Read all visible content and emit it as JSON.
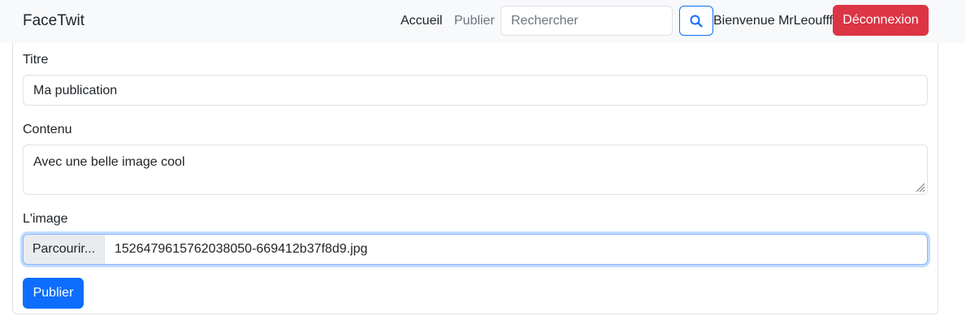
{
  "navbar": {
    "brand": "FaceTwit",
    "links": [
      {
        "label": "Accueil",
        "active": true
      },
      {
        "label": "Publier",
        "active": false
      }
    ],
    "search": {
      "placeholder": "Rechercher",
      "value": "",
      "icon": "search-icon"
    },
    "welcome_text": "Bienvenue MrLeoufff",
    "logout_label": "Déconnexion"
  },
  "form": {
    "title": {
      "label": "Titre",
      "value": "Ma publication"
    },
    "content": {
      "label": "Contenu",
      "value": "Avec une belle image cool"
    },
    "image": {
      "label": "L'image",
      "browse_label": "Parcourir...",
      "filename": "1526479615762038050-669412b37f8d9.jpg"
    },
    "submit_label": "Publier"
  },
  "colors": {
    "primary": "#0d6efd",
    "danger": "#dc3545",
    "navbar_bg": "#f8f9fa",
    "muted": "#6c757d"
  }
}
